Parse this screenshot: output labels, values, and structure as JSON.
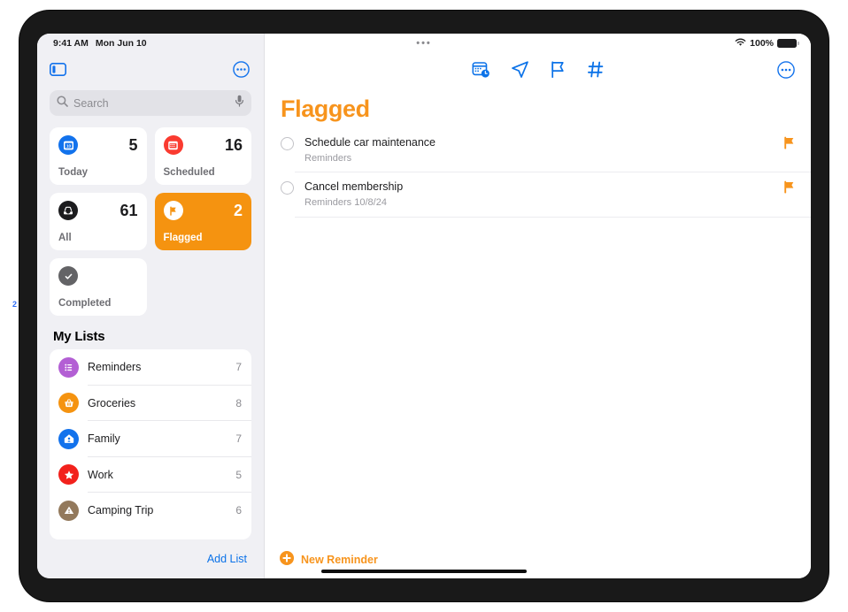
{
  "annotation": {
    "marker_label": "2"
  },
  "status_bar": {
    "time": "9:41 AM",
    "date": "Mon Jun 10",
    "wifi_icon": "wifi-icon",
    "battery_percent": "100%",
    "battery_icon": "battery-full-icon",
    "camera_dots": "•••"
  },
  "sidebar": {
    "toggle_icon": "sidebar-toggle-icon",
    "more_icon": "more-ellipsis-circle-icon",
    "search": {
      "placeholder": "Search",
      "search_icon": "search-icon",
      "mic_icon": "microphone-icon"
    },
    "smart_lists": [
      {
        "label": "Today",
        "count": "5",
        "icon": "calendar-day-icon",
        "icon_color": "#1272ec",
        "selected": false
      },
      {
        "label": "Scheduled",
        "count": "16",
        "icon": "calendar-icon",
        "icon_color": "#fa3b30",
        "selected": false
      },
      {
        "label": "All",
        "count": "61",
        "icon": "inbox-tray-icon",
        "icon_color": "#1c1c1e",
        "selected": false
      },
      {
        "label": "Flagged",
        "count": "2",
        "icon": "flag-icon",
        "icon_color": "#ffffff",
        "selected": true
      },
      {
        "label": "Completed",
        "count": "",
        "icon": "checkmark-circle-icon",
        "icon_color": "#636366",
        "selected": false
      }
    ],
    "my_lists_header": "My Lists",
    "lists": [
      {
        "name": "Reminders",
        "count": "7",
        "icon": "list-bullet-icon",
        "icon_color": "#b35fd4"
      },
      {
        "name": "Groceries",
        "count": "8",
        "icon": "basket-icon",
        "icon_color": "#f59310"
      },
      {
        "name": "Family",
        "count": "7",
        "icon": "house-icon",
        "icon_color": "#1272ec"
      },
      {
        "name": "Work",
        "count": "5",
        "icon": "star-icon",
        "icon_color": "#f2211c"
      },
      {
        "name": "Camping Trip",
        "count": "6",
        "icon": "triangle-warning-icon",
        "icon_color": "#93795c"
      }
    ],
    "add_list_label": "Add List"
  },
  "content": {
    "toolbar_icons": [
      {
        "name": "calendar-clock-icon",
        "color": "#0b72e8"
      },
      {
        "name": "location-arrow-icon",
        "color": "#0b72e8"
      },
      {
        "name": "flag-outline-icon",
        "color": "#0b72e8"
      },
      {
        "name": "hashtag-icon",
        "color": "#0b72e8"
      }
    ],
    "more_icon": "more-ellipsis-circle-icon",
    "title": "Flagged",
    "title_color": "#f7941d",
    "reminders": [
      {
        "title": "Schedule car maintenance",
        "subtitle": "Reminders",
        "flagged": true
      },
      {
        "title": "Cancel membership",
        "subtitle": "Reminders  10/8/24",
        "flagged": true
      }
    ],
    "new_reminder": {
      "label": "New Reminder",
      "icon": "plus-circle-icon",
      "color": "#f7941d"
    }
  },
  "home_indicator": "home-indicator"
}
